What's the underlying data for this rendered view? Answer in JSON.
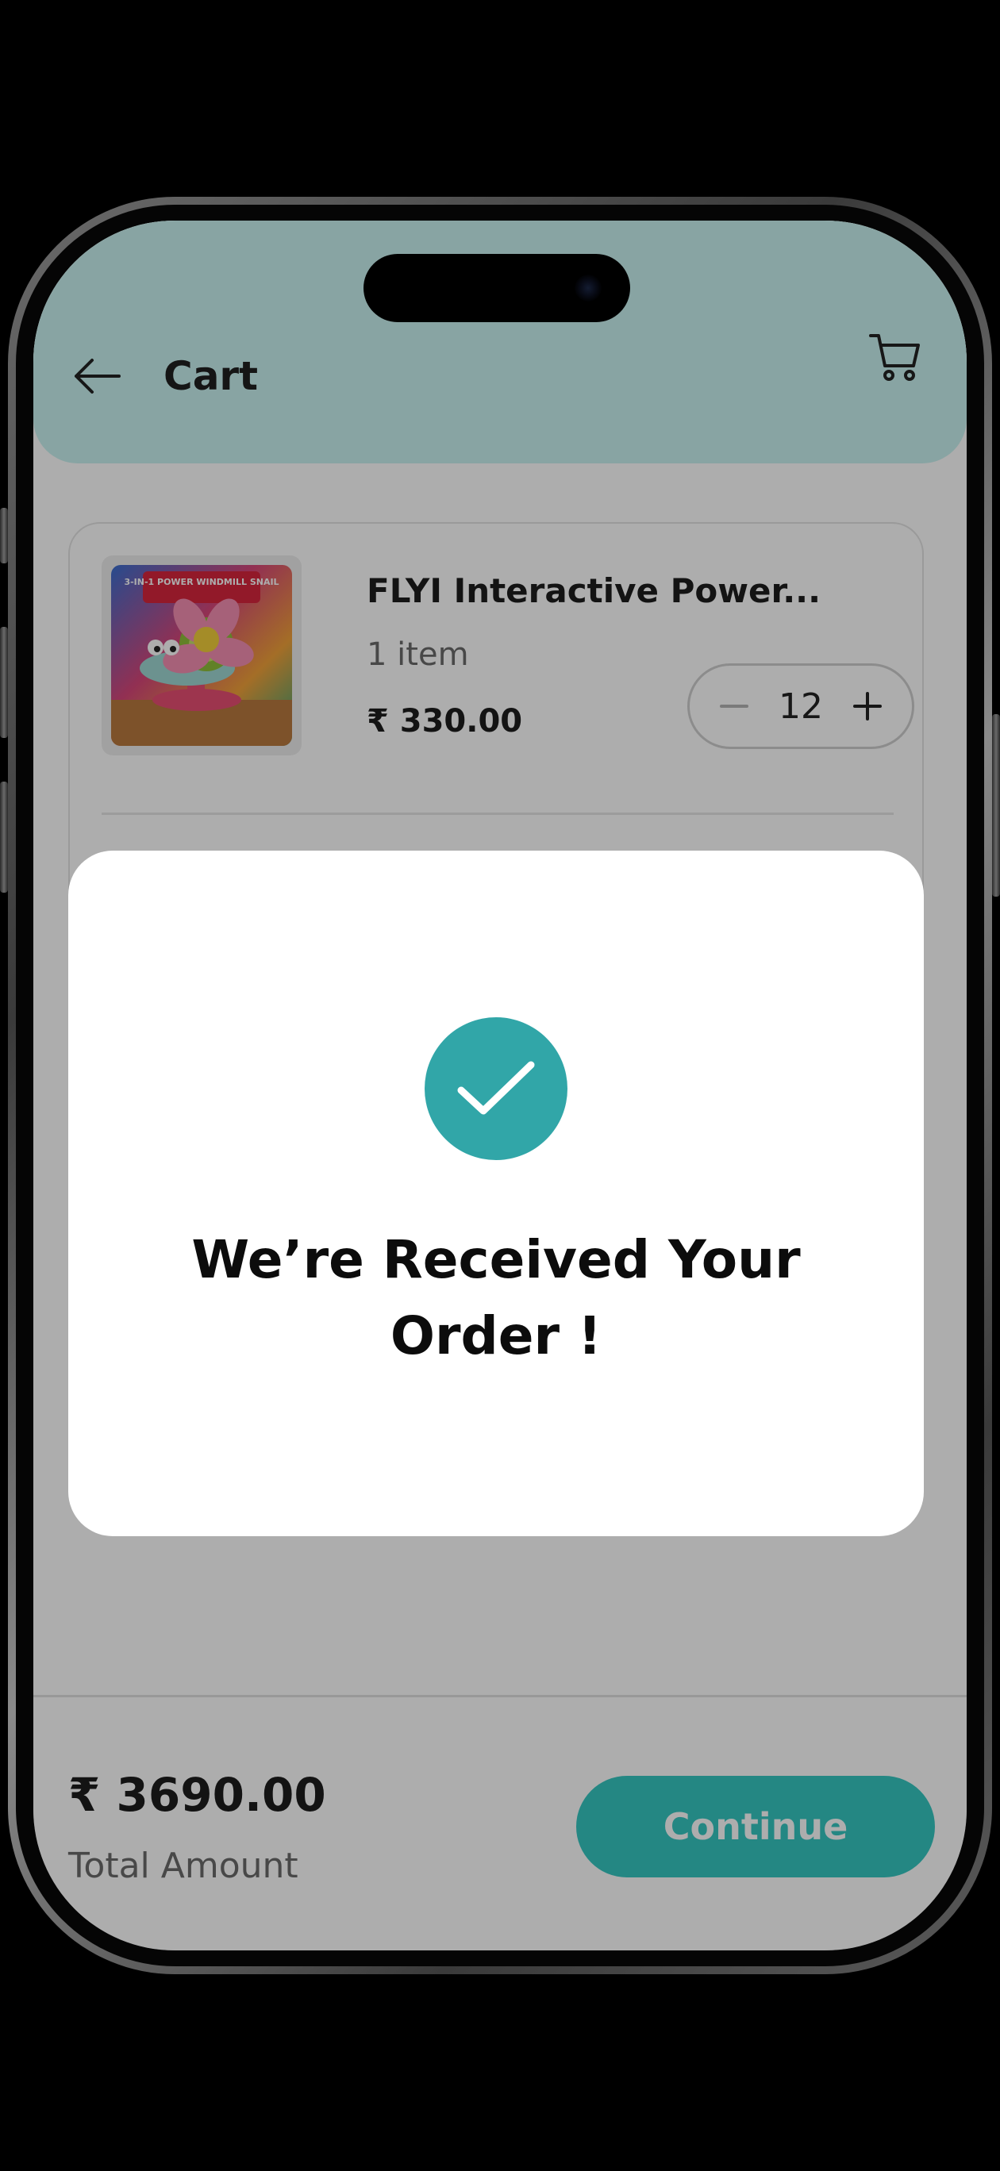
{
  "header": {
    "title": "Cart",
    "background_color": "#c9f2f0"
  },
  "cart": {
    "item": {
      "name": "FLYI Interactive Power...",
      "image_caption": "3-IN-1 POWER WINDMILL SNAIL",
      "quantity_label": "1 item",
      "price": "₹ 330.00",
      "stepper_value": "12"
    }
  },
  "footer": {
    "total_amount": "₹ 3690.00",
    "total_label": "Total Amount",
    "continue_label": "Continue",
    "accent_color": "#36c7c2"
  },
  "dialog": {
    "message": "We’re Received Your Order !",
    "icon": "check-icon",
    "icon_color": "#31a6a8"
  },
  "icons": {
    "back": "arrow-left-icon",
    "cart": "cart-icon",
    "decrement": "minus-icon",
    "increment": "plus-icon"
  }
}
